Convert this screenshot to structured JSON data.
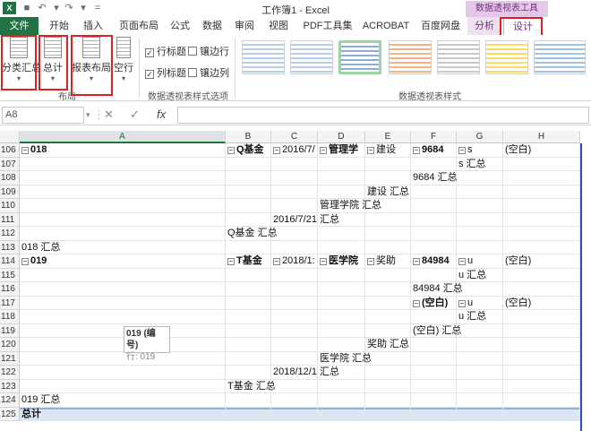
{
  "titlebar": {
    "app_icon": "X",
    "title": "工作簿1 - Excel",
    "context_tools": "数据透视表工具"
  },
  "tabs": [
    {
      "label": "文件"
    },
    {
      "label": "开始"
    },
    {
      "label": "插入"
    },
    {
      "label": "页面布局"
    },
    {
      "label": "公式"
    },
    {
      "label": "数据"
    },
    {
      "label": "审阅"
    },
    {
      "label": "视图"
    },
    {
      "label": "PDF工具集"
    },
    {
      "label": "ACROBAT"
    },
    {
      "label": "百度网盘"
    },
    {
      "label": "分析"
    },
    {
      "label": "设计"
    }
  ],
  "ribbon": {
    "layout_buttons": [
      {
        "label": "分类汇总"
      },
      {
        "label": "总计"
      },
      {
        "label": "报表布局"
      },
      {
        "label": "空行"
      }
    ],
    "layout_group_label": "布局",
    "options": {
      "row_headers": "行标题",
      "banded_rows": "镶边行",
      "col_headers": "列标题",
      "banded_cols": "镶边列"
    },
    "options_group_label": "数据透视表样式选项",
    "styles_group_label": "数据透视表样式"
  },
  "formula_bar": {
    "name_box": "A8",
    "fx": "fx",
    "value": ""
  },
  "columns": [
    "A",
    "B",
    "C",
    "D",
    "E",
    "F",
    "G",
    "H"
  ],
  "rows": [
    {
      "n": "106",
      "cells": {
        "A": "018",
        "B": "Q基金",
        "C": "2016/7/",
        "D": "管理学",
        "E": "建设",
        "F": "9684",
        "G": "s",
        "H": "(空白)"
      }
    },
    {
      "n": "107",
      "cells": {
        "G": "s 汇总"
      }
    },
    {
      "n": "108",
      "cells": {
        "F": "9684 汇总"
      }
    },
    {
      "n": "109",
      "cells": {
        "E": "建设 汇总"
      }
    },
    {
      "n": "110",
      "cells": {
        "D": "管理学院 汇总"
      }
    },
    {
      "n": "111",
      "cells": {
        "C": "2016/7/21 汇总"
      }
    },
    {
      "n": "112",
      "cells": {
        "B": "Q基金 汇总"
      }
    },
    {
      "n": "113",
      "cells": {
        "A": "018 汇总"
      }
    },
    {
      "n": "114",
      "cells": {
        "A": "019",
        "B": "T基金",
        "C": "2018/1:",
        "D": "医学院",
        "E": "奖助",
        "F": "84984",
        "G": "u",
        "H": "(空白)"
      }
    },
    {
      "n": "115",
      "cells": {
        "G": "u 汇总"
      }
    },
    {
      "n": "116",
      "cells": {
        "F": "84984 汇总"
      }
    },
    {
      "n": "117",
      "cells": {
        "F": "(空白)",
        "G": "u",
        "H": "(空白)"
      }
    },
    {
      "n": "118",
      "cells": {
        "G": "u 汇总"
      }
    },
    {
      "n": "119",
      "cells": {
        "F": "(空白) 汇总"
      }
    },
    {
      "n": "120",
      "cells": {
        "E": "奖助 汇总"
      }
    },
    {
      "n": "121",
      "cells": {
        "D": "医学院 汇总"
      }
    },
    {
      "n": "122",
      "cells": {
        "C": "2018/12/1 汇总"
      }
    },
    {
      "n": "123",
      "cells": {
        "B": "T基金 汇总"
      }
    },
    {
      "n": "124",
      "cells": {
        "A": "019 汇总"
      }
    },
    {
      "n": "125",
      "cells": {
        "A": "总计"
      }
    }
  ],
  "tooltip": {
    "line1": "019 (编号)",
    "line2": "行: 019"
  },
  "colors": {
    "excel_green": "#217346",
    "context_purple": "#7a2a85",
    "highlight_red": "#e02020",
    "total_row": "#dce6f1"
  }
}
